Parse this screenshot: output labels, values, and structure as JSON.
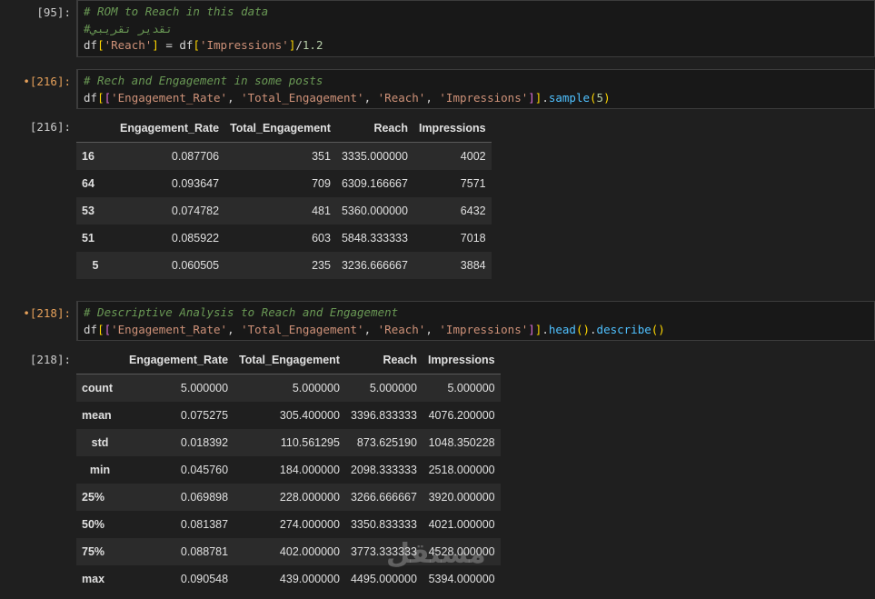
{
  "cells": [
    {
      "prompt": "[95]:",
      "lines": [
        "# ROM to Reach in this data",
        "#تقدير تقريبي",
        "df['Reach'] = df['Impressions']/1.2"
      ]
    },
    {
      "prompt": "[216]:",
      "modified": "•",
      "lines": [
        "# Rech and Engagement in some posts",
        "df[['Engagement_Rate', 'Total_Engagement', 'Reach', 'Impressions']].sample(5)"
      ],
      "out_prompt": "[216]:",
      "table": {
        "columns": [
          "",
          "Engagement_Rate",
          "Total_Engagement",
          "Reach",
          "Impressions"
        ],
        "rows": [
          {
            "index": "16",
            "values": [
              "0.087706",
              "351",
              "3335.000000",
              "4002"
            ]
          },
          {
            "index": "64",
            "values": [
              "0.093647",
              "709",
              "6309.166667",
              "7571"
            ]
          },
          {
            "index": "53",
            "values": [
              "0.074782",
              "481",
              "5360.000000",
              "6432"
            ]
          },
          {
            "index": "51",
            "values": [
              "0.085922",
              "603",
              "5848.333333",
              "7018"
            ]
          },
          {
            "index": "5",
            "values": [
              "0.060505",
              "235",
              "3236.666667",
              "3884"
            ]
          }
        ]
      }
    },
    {
      "prompt": "[218]:",
      "modified": "•",
      "lines": [
        "# Descriptive Analysis to Reach and Engagement",
        "df[['Engagement_Rate', 'Total_Engagement', 'Reach', 'Impressions']].head().describe()"
      ],
      "out_prompt": "[218]:",
      "table": {
        "columns": [
          "",
          "Engagement_Rate",
          "Total_Engagement",
          "Reach",
          "Impressions"
        ],
        "rows": [
          {
            "index": "count",
            "values": [
              "5.000000",
              "5.000000",
              "5.000000",
              "5.000000"
            ]
          },
          {
            "index": "mean",
            "values": [
              "0.075275",
              "305.400000",
              "3396.833333",
              "4076.200000"
            ]
          },
          {
            "index": "std",
            "values": [
              "0.018392",
              "110.561295",
              "873.625190",
              "1048.350228"
            ]
          },
          {
            "index": "min",
            "values": [
              "0.045760",
              "184.000000",
              "2098.333333",
              "2518.000000"
            ]
          },
          {
            "index": "25%",
            "values": [
              "0.069898",
              "228.000000",
              "3266.666667",
              "3920.000000"
            ]
          },
          {
            "index": "50%",
            "values": [
              "0.081387",
              "274.000000",
              "3350.833333",
              "4021.000000"
            ]
          },
          {
            "index": "75%",
            "values": [
              "0.088781",
              "402.000000",
              "3773.333333",
              "4528.000000"
            ]
          },
          {
            "index": "max",
            "values": [
              "0.090548",
              "439.000000",
              "4495.000000",
              "5394.000000"
            ]
          }
        ]
      }
    }
  ],
  "watermark": "مستقل"
}
